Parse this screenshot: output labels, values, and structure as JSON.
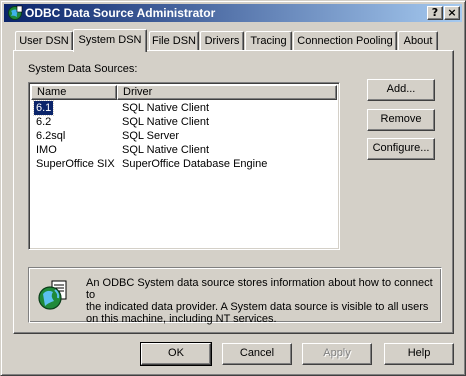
{
  "window": {
    "title": "ODBC Data Source Administrator",
    "help_button": "?",
    "close_button": "×"
  },
  "tabs": [
    {
      "label": "User DSN",
      "active": false
    },
    {
      "label": "System DSN",
      "active": true
    },
    {
      "label": "File DSN",
      "active": false
    },
    {
      "label": "Drivers",
      "active": false
    },
    {
      "label": "Tracing",
      "active": false
    },
    {
      "label": "Connection Pooling",
      "active": false
    },
    {
      "label": "About",
      "active": false
    }
  ],
  "system_dsn": {
    "group_label": "System Data Sources:",
    "columns": {
      "name": "Name",
      "driver": "Driver"
    },
    "rows": [
      {
        "name": "6.1",
        "driver": "SQL Native Client",
        "selected": true
      },
      {
        "name": "6.2",
        "driver": "SQL Native Client",
        "selected": false
      },
      {
        "name": "6.2sql",
        "driver": "SQL Server",
        "selected": false
      },
      {
        "name": "IMO",
        "driver": "SQL Native Client",
        "selected": false
      },
      {
        "name": "SuperOffice SIX",
        "driver": "SuperOffice Database Engine",
        "selected": false
      }
    ],
    "buttons": {
      "add": "Add...",
      "remove": "Remove",
      "configure": "Configure..."
    },
    "info_text": "An ODBC System data source stores information about how to connect to\nthe indicated data provider.   A System data source is visible to all users\non this machine, including NT services."
  },
  "footer": {
    "ok": "OK",
    "cancel": "Cancel",
    "apply": "Apply",
    "help": "Help"
  },
  "colors": {
    "titlebar_start": "#0a246a",
    "titlebar_end": "#a6caf0",
    "face": "#d4d0c8",
    "selection": "#0a246a"
  }
}
